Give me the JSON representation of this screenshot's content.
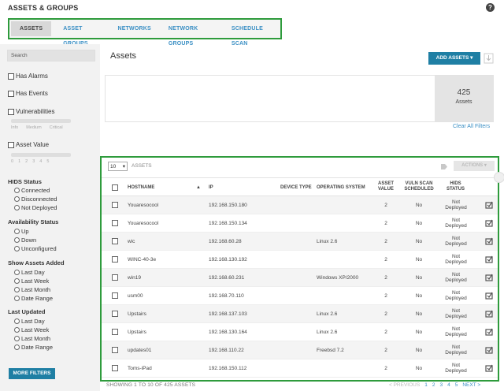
{
  "header": {
    "title": "ASSETS & GROUPS",
    "help": "?"
  },
  "tabs": [
    {
      "label": "ASSETS"
    },
    {
      "label": "ASSET GROUPS"
    },
    {
      "label": "NETWORKS"
    },
    {
      "label": "NETWORK GROUPS"
    },
    {
      "label": "SCHEDULE SCAN"
    }
  ],
  "sidebar": {
    "search_placeholder": "Search",
    "filters": {
      "has_alarms": "Has Alarms",
      "has_events": "Has Events",
      "vulnerabilities": "Vulnerabilities",
      "vuln_levels": [
        "Info",
        "Medium",
        "Critical"
      ],
      "asset_value": "Asset Value",
      "asset_value_ticks": [
        "0",
        "1",
        "2",
        "3",
        "4",
        "5"
      ]
    },
    "hids_status": {
      "title": "HIDS Status",
      "options": [
        "Connected",
        "Disconnected",
        "Not Deployed"
      ]
    },
    "availability": {
      "title": "Availability Status",
      "options": [
        "Up",
        "Down",
        "Unconfigured"
      ]
    },
    "assets_added": {
      "title": "Show Assets Added",
      "options": [
        "Last Day",
        "Last Week",
        "Last Month",
        "Date Range"
      ]
    },
    "last_updated": {
      "title": "Last Updated",
      "options": [
        "Last Day",
        "Last Week",
        "Last Month",
        "Date Range"
      ]
    },
    "more_filters": "MORE FILTERS"
  },
  "main": {
    "title": "Assets",
    "add_assets": "ADD ASSETS",
    "summary": {
      "count": "425",
      "label": "Assets"
    },
    "clear_filters": "Clear All Filters"
  },
  "table": {
    "per_page": "10",
    "per_page_label": "ASSETS",
    "actions": "ACTIONS",
    "headers": {
      "hostname": "HOSTNAME",
      "ip": "IP",
      "device_type": "DEVICE TYPE",
      "os": "OPERATING SYSTEM",
      "asset_value": "ASSET VALUE",
      "vuln_scan": "VULN SCAN SCHEDULED",
      "hids": "HIDS STATUS"
    },
    "rows": [
      {
        "hostname": "Youaresocool",
        "ip": "192.168.150.180",
        "device": "",
        "os": "",
        "value": "2",
        "vuln": "No",
        "hids": "Not Deployed"
      },
      {
        "hostname": "Youaresocool",
        "ip": "192.168.150.134",
        "device": "",
        "os": "",
        "value": "2",
        "vuln": "No",
        "hids": "Not Deployed"
      },
      {
        "hostname": "wic",
        "ip": "192.168.60.28",
        "device": "",
        "os": "Linux 2.6",
        "value": "2",
        "vuln": "No",
        "hids": "Not Deployed"
      },
      {
        "hostname": "WINC-40-3e",
        "ip": "192.168.130.192",
        "device": "",
        "os": "",
        "value": "2",
        "vuln": "No",
        "hids": "Not Deployed"
      },
      {
        "hostname": "win19",
        "ip": "192.168.60.231",
        "device": "",
        "os": "Windows XP/2000",
        "value": "2",
        "vuln": "No",
        "hids": "Not Deployed"
      },
      {
        "hostname": "usm00",
        "ip": "192.168.70.110",
        "device": "",
        "os": "",
        "value": "2",
        "vuln": "No",
        "hids": "Not Deployed"
      },
      {
        "hostname": "Upstairs",
        "ip": "192.168.137.103",
        "device": "",
        "os": "Linux 2.6",
        "value": "2",
        "vuln": "No",
        "hids": "Not Deployed"
      },
      {
        "hostname": "Upstairs",
        "ip": "192.168.130.164",
        "device": "",
        "os": "Linux 2.6",
        "value": "2",
        "vuln": "No",
        "hids": "Not Deployed"
      },
      {
        "hostname": "updates01",
        "ip": "192.168.110.22",
        "device": "",
        "os": "Freebsd 7.2",
        "value": "2",
        "vuln": "No",
        "hids": "Not Deployed"
      },
      {
        "hostname": "Toms-iPad",
        "ip": "192.168.150.112",
        "device": "",
        "os": "",
        "value": "2",
        "vuln": "No",
        "hids": "Not Deployed"
      }
    ]
  },
  "footer": {
    "showing": "SHOWING 1 TO 10 OF 425 ASSETS",
    "previous": "< PREVIOUS",
    "pages": [
      "1",
      "2",
      "3",
      "4",
      "5"
    ],
    "next": "NEXT >"
  },
  "colors": {
    "accent": "#1f7fa4",
    "link": "#3a8fc4",
    "highlight": "#2e9b3c"
  }
}
